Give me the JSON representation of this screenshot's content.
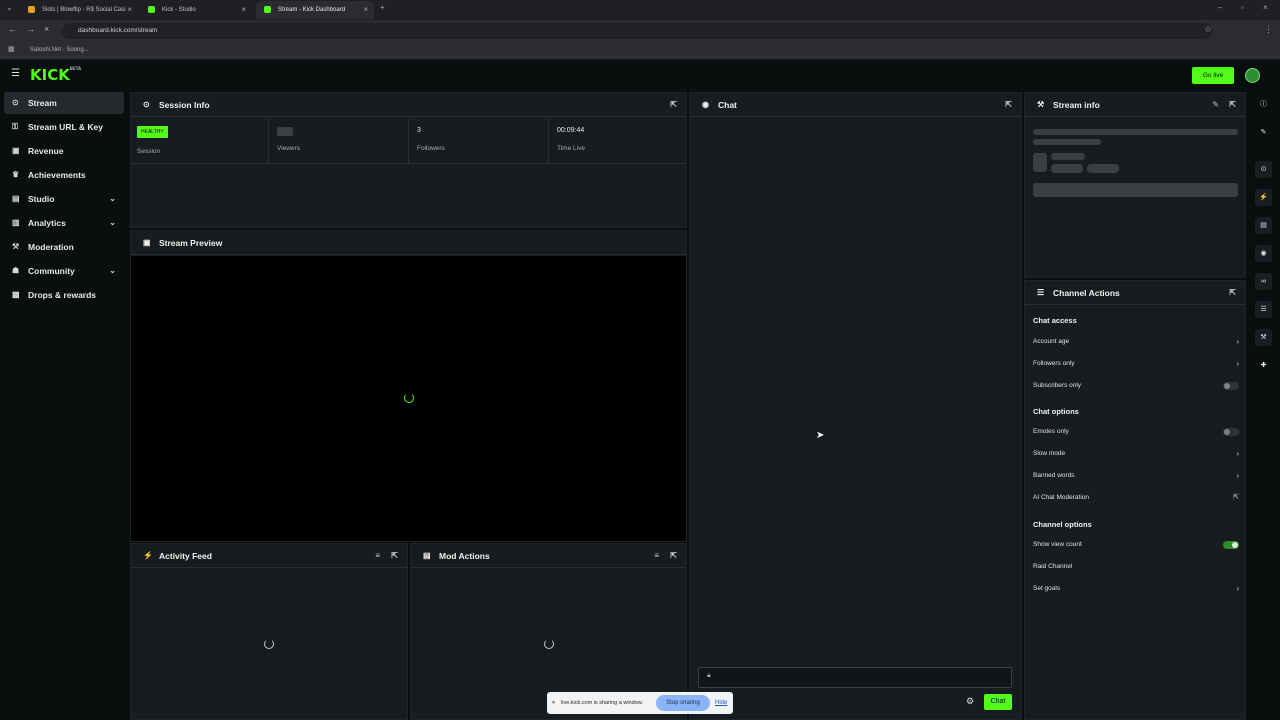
{
  "browser": {
    "tabs": [
      {
        "title": "Slots | Blowflip - R$ Social Casi"
      },
      {
        "title": "Kick - Studio"
      },
      {
        "title": "Stream - Kick Dashboard"
      }
    ],
    "url": "dashboard.kick.com/stream",
    "bookmark": "Satoshi.Net - Soong..."
  },
  "header": {
    "logo": "KICK",
    "logo_sup": "BETA",
    "go_live": "Go live"
  },
  "sidebar": {
    "items": [
      {
        "label": "Stream"
      },
      {
        "label": "Stream URL & Key"
      },
      {
        "label": "Revenue"
      },
      {
        "label": "Achievements"
      },
      {
        "label": "Studio"
      },
      {
        "label": "Analytics"
      },
      {
        "label": "Moderation"
      },
      {
        "label": "Community"
      },
      {
        "label": "Drops & rewards"
      }
    ]
  },
  "session": {
    "title": "Session Info",
    "badge": "HEALTHY",
    "session_label": "Session",
    "viewers_label": "Viewers",
    "followers_value": "3",
    "followers_label": "Followers",
    "time_value": "00:09:44",
    "time_label": "Time Live"
  },
  "preview": {
    "title": "Stream Preview"
  },
  "activity": {
    "title": "Activity Feed"
  },
  "mod_actions": {
    "title": "Mod Actions"
  },
  "chat": {
    "title": "Chat",
    "send_label": "Chat"
  },
  "stream_info": {
    "title": "Stream info"
  },
  "channel_actions": {
    "title": "Channel Actions",
    "sections": [
      {
        "heading": "Chat access"
      },
      {
        "heading": "Chat options"
      },
      {
        "heading": "Channel options"
      }
    ],
    "items": [
      {
        "label": "Account age",
        "control": "arrow"
      },
      {
        "label": "Followers only",
        "control": "arrow"
      },
      {
        "label": "Subscribers only",
        "control": "toggle",
        "on": false
      },
      {
        "label": "Emotes only",
        "control": "toggle",
        "on": false
      },
      {
        "label": "Slow mode",
        "control": "arrow"
      },
      {
        "label": "Banned words",
        "control": "arrow"
      },
      {
        "label": "AI Chat Moderation",
        "control": "external"
      },
      {
        "label": "Show view count",
        "control": "toggle",
        "on": true
      },
      {
        "label": "Raid Channel",
        "control": "none"
      },
      {
        "label": "Set goals",
        "control": "arrow"
      }
    ]
  },
  "share_bar": {
    "text": "live.kick.com is sharing a window.",
    "stop": "Stop sharing",
    "hide": "Hide"
  },
  "colors": {
    "accent": "#53fc18",
    "background": "#0b0e0f",
    "panel": "#181c1e"
  },
  "icons": {
    "stream": "radio-icon",
    "key": "key-icon",
    "revenue": "money-icon",
    "achievements": "trophy-icon",
    "studio": "studio-icon",
    "analytics": "chart-icon",
    "moderation": "wrench-icon",
    "community": "people-icon",
    "drops": "gift-icon"
  }
}
